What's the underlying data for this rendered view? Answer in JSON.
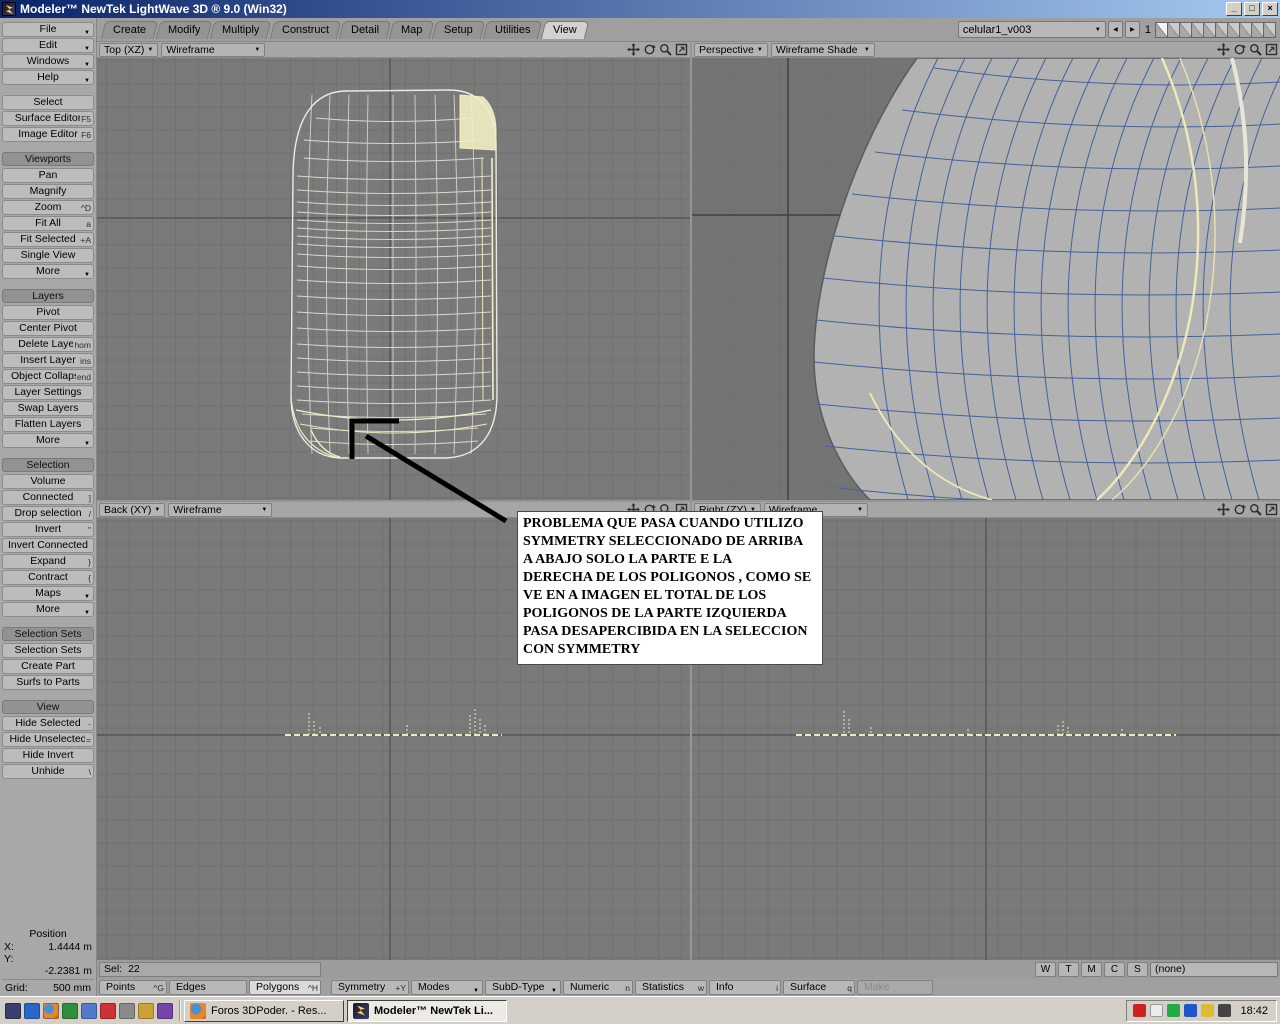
{
  "window": {
    "title": "Modeler™ NewTek LightWave 3D ® 9.0 (Win32)"
  },
  "icons": {
    "dropdown_arrow": "▼",
    "minimize": "_",
    "maximize": "□",
    "close": "×",
    "layer_prev": "◀",
    "layer_next": "▶"
  },
  "tabs": [
    {
      "label": "Create"
    },
    {
      "label": "Modify"
    },
    {
      "label": "Multiply"
    },
    {
      "label": "Construct"
    },
    {
      "label": "Detail"
    },
    {
      "label": "Map"
    },
    {
      "label": "Setup"
    },
    {
      "label": "Utilities"
    },
    {
      "label": "View",
      "active": true
    }
  ],
  "top_right": {
    "object_selector": "celular1_v003",
    "layer_bank": "1"
  },
  "sidebar": {
    "menus": [
      {
        "label": "File"
      },
      {
        "label": "Edit"
      },
      {
        "label": "Windows"
      },
      {
        "label": "Help"
      }
    ],
    "tools": [
      {
        "label": "Select"
      },
      {
        "label": "Surface Editor",
        "shortcut": "F5"
      },
      {
        "label": "Image Editor",
        "shortcut": "F6"
      }
    ],
    "viewports_section": {
      "header": "Viewports",
      "items": [
        {
          "label": "Pan"
        },
        {
          "label": "Magnify"
        },
        {
          "label": "Zoom",
          "shortcut": "^D"
        },
        {
          "label": "Fit All",
          "shortcut": "a"
        },
        {
          "label": "Fit Selected",
          "shortcut": "+A"
        },
        {
          "label": "Single View"
        },
        {
          "label": "More"
        }
      ]
    },
    "layers_section": {
      "header": "Layers",
      "items": [
        {
          "label": "Pivot"
        },
        {
          "label": "Center Pivot"
        },
        {
          "label": "Delete Layer",
          "shortcut": "hom"
        },
        {
          "label": "Insert Layer",
          "shortcut": "ins"
        },
        {
          "label": "Object Collapse",
          "shortcut": "end"
        },
        {
          "label": "Layer Settings"
        },
        {
          "label": "Swap Layers"
        },
        {
          "label": "Flatten Layers"
        },
        {
          "label": "More"
        }
      ]
    },
    "selection_section": {
      "header": "Selection",
      "items": [
        {
          "label": "Volume"
        },
        {
          "label": "Connected",
          "shortcut": "]"
        },
        {
          "label": "Drop selection",
          "shortcut": "/"
        },
        {
          "label": "Invert",
          "shortcut": "\""
        },
        {
          "label": "Invert Connected"
        },
        {
          "label": "Expand",
          "shortcut": "}"
        },
        {
          "label": "Contract",
          "shortcut": "{"
        },
        {
          "label": "Maps"
        },
        {
          "label": "More"
        }
      ]
    },
    "selection_sets_section": {
      "header": "Selection Sets",
      "items": [
        {
          "label": "Selection Sets"
        },
        {
          "label": "Create Part"
        },
        {
          "label": "Surfs to Parts"
        }
      ]
    },
    "view_section": {
      "header": "View",
      "items": [
        {
          "label": "Hide Selected",
          "shortcut": "-"
        },
        {
          "label": "Hide Unselected",
          "shortcut": "="
        },
        {
          "label": "Hide Invert"
        },
        {
          "label": "Unhide",
          "shortcut": "\\"
        }
      ]
    },
    "position": {
      "header": "Position",
      "x_label": "X:",
      "x_value": "1.4444 m",
      "y_label": "Y:",
      "z_value": "-2.2381 m"
    },
    "grid_label": "Grid:",
    "grid_value": "500 mm"
  },
  "viewports": {
    "top_left": {
      "view": "Top",
      "axis": "(XZ)",
      "mode": "Wireframe"
    },
    "top_right": {
      "view": "Perspective",
      "mode": "Wireframe Shade"
    },
    "bottom_left": {
      "view": "Back",
      "axis": "(XY)",
      "mode": "Wireframe"
    },
    "bottom_right": {
      "view": "Right",
      "axis": "(ZY)",
      "mode": "Wireframe"
    }
  },
  "annotation": {
    "lines": [
      "PROBLEMA QUE PASA CUANDO UTILIZO",
      "SYMMETRY SELECCIONADO DE ARRIBA",
      "A ABAJO SOLO LA PARTE E LA",
      "DERECHA DE LOS POLIGONOS , COMO SE",
      "VE EN A IMAGEN EL TOTAL DE LOS",
      "POLIGONOS DE LA PARTE IZQUIERDA",
      "PASA DESAPERCIBIDA EN LA SELECCION",
      "CON SYMMETRY"
    ]
  },
  "status": {
    "sel_label": "Sel:",
    "sel_value": "22",
    "vmap_buttons": [
      {
        "label": "W"
      },
      {
        "label": "T"
      },
      {
        "label": "M"
      },
      {
        "label": "C"
      },
      {
        "label": "S"
      }
    ],
    "vmap_name": "(none)",
    "points": {
      "label": "Points",
      "shortcut": "^G"
    },
    "edges": {
      "label": "Edges"
    },
    "polygons": {
      "label": "Polygons",
      "shortcut": "^H"
    },
    "symmetry": {
      "label": "Symmetry",
      "shortcut": "+Y"
    },
    "modes": {
      "label": "Modes"
    },
    "subd": {
      "label": "SubD-Type"
    },
    "numeric": {
      "label": "Numeric",
      "shortcut": "n"
    },
    "statistics": {
      "label": "Statistics",
      "shortcut": "w"
    },
    "info": {
      "label": "Info",
      "shortcut": "i"
    },
    "surface": {
      "label": "Surface",
      "shortcut": "q"
    },
    "make": {
      "label": "Make"
    }
  },
  "taskbar": {
    "tasks": [
      {
        "label": "Foros 3DPoder. - Res..."
      },
      {
        "label": "Modeler™ NewTek Li...",
        "active": true
      }
    ],
    "clock": "18:42"
  }
}
